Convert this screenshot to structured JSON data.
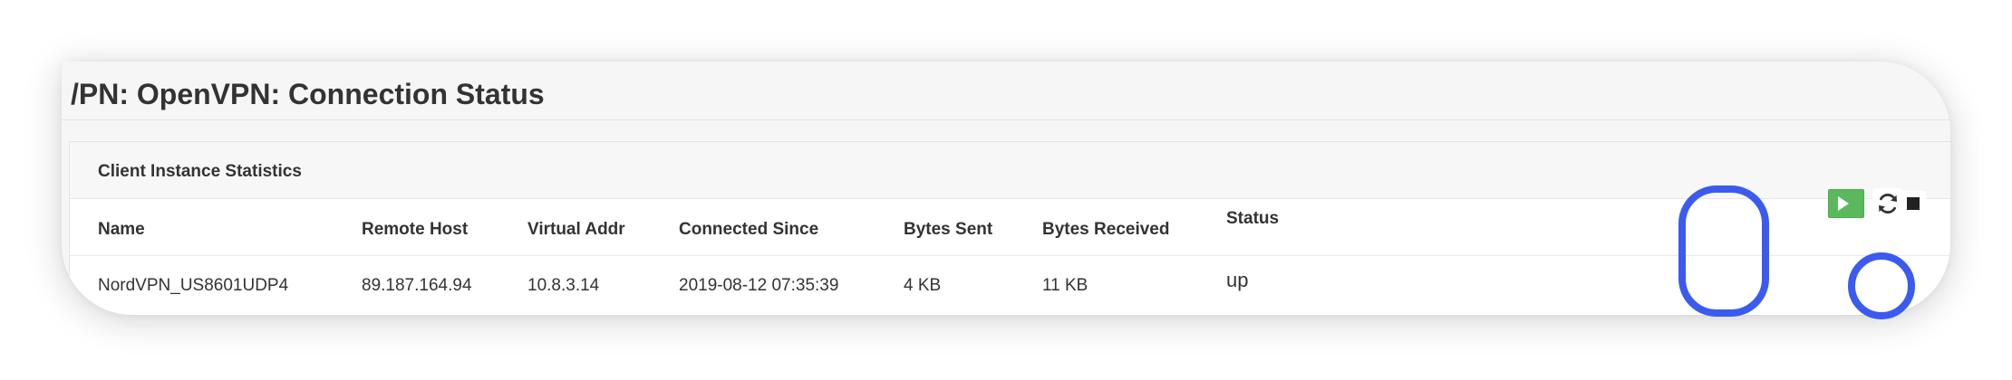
{
  "page": {
    "title": "/PN: OpenVPN: Connection Status"
  },
  "panel": {
    "title": "Client Instance Statistics"
  },
  "table": {
    "columns": [
      "Name",
      "Remote Host",
      "Virtual Addr",
      "Connected Since",
      "Bytes Sent",
      "Bytes Received",
      "Status"
    ],
    "rows": [
      [
        "NordVPN_US8601UDP4",
        "89.187.164.94",
        "10.8.3.14",
        "2019-08-12 07:35:39",
        "4 KB",
        "11 KB",
        "up"
      ]
    ]
  },
  "actions": {
    "icons": [
      "play-icon",
      "refresh-icon",
      "stop-icon"
    ]
  },
  "colors": {
    "highlight": "#3b5bf0",
    "start_button": "#5cb85c"
  }
}
